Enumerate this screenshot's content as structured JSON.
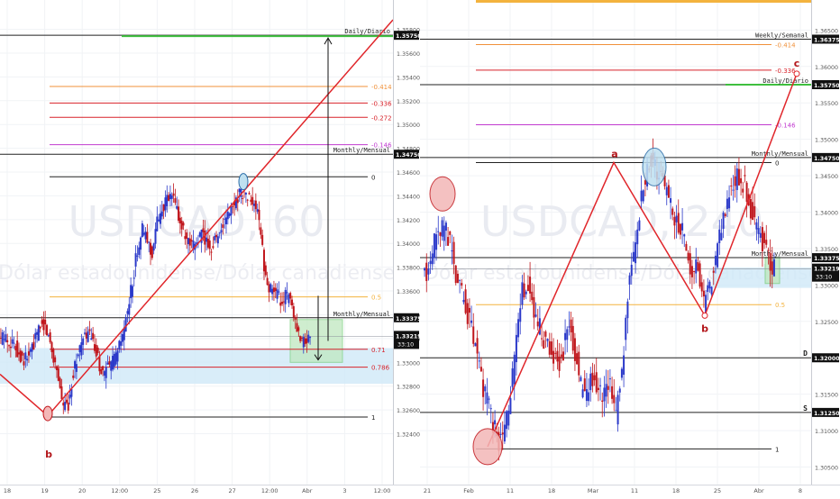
{
  "colors": {
    "up": "#2b39c9",
    "down": "#c0161c",
    "trend": "#e0262b",
    "grid": "#f1f3f6",
    "axis": "#555555",
    "fib_red": "#d8222a",
    "fib_orange": "#f0913a",
    "fib_purple": "#c13bd0",
    "fib_gold": "#f3b33e",
    "zone_blue": "#cfe8f8",
    "zone_green": "#bfe8c0",
    "label_red": "#b3151a"
  },
  "chart_data": [
    {
      "type": "candlestick",
      "watermark": "USDCAD, 60",
      "watermark_sub": "Dólar estadounidense/Dólar canadiense",
      "ylim": [
        1.3226,
        1.3588
      ],
      "y_ticks": [
        1.324,
        1.326,
        1.328,
        1.33,
        1.332,
        1.334,
        1.336,
        1.338,
        1.34,
        1.342,
        1.344,
        1.346,
        1.348,
        1.35,
        1.352,
        1.354,
        1.356,
        1.358
      ],
      "y_tick_labels": [
        "1.32400",
        "1.32600",
        "1.32800",
        "1.33000",
        "1.33200",
        "1.33400",
        "1.33600",
        "1.33800",
        "1.34000",
        "1.34200",
        "1.34400",
        "1.34600",
        "1.34800",
        "1.35000",
        "1.35200",
        "1.35400",
        "1.35600",
        "1.35800"
      ],
      "x_ticks": [
        "18",
        "19",
        "20",
        "12:00",
        "25",
        "26",
        "27",
        "12:00",
        "Abr",
        "3",
        "12:00"
      ],
      "levels": [
        {
          "label": "Daily/Diario",
          "value": 1.3575,
          "price_tag": "1.35750"
        },
        {
          "label": "Monthly/Mensual",
          "value": 1.3475,
          "price_tag": "1.34750"
        },
        {
          "label": "Monthly/Mensual",
          "value": 1.33375,
          "price_tag": "1.33375"
        }
      ],
      "current_price": "1.33219",
      "countdown": "33:10",
      "fib_levels": [
        {
          "label": "-0.414",
          "value": 1.3532
        },
        {
          "label": "-0.336",
          "value": 1.3518
        },
        {
          "label": "-0.272",
          "value": 1.3506
        },
        {
          "label": "-0.146",
          "value": 1.3483
        },
        {
          "label": "0",
          "value": 1.3456
        },
        {
          "label": "0.5",
          "value": 1.3355
        },
        {
          "label": "0.71",
          "value": 1.3311
        },
        {
          "label": "0.786",
          "value": 1.3296
        },
        {
          "label": "1",
          "value": 1.3254
        }
      ],
      "pattern_labels": [
        "b"
      ],
      "series": [
        {
          "name": "price",
          "values": [
            1.3322,
            1.3318,
            1.3315,
            1.3308,
            1.3302,
            1.3306,
            1.3315,
            1.3328,
            1.3333,
            1.3322,
            1.3305,
            1.3288,
            1.3262,
            1.3265,
            1.3292,
            1.3308,
            1.3318,
            1.3325,
            1.3316,
            1.3302,
            1.329,
            1.3295,
            1.33,
            1.3308,
            1.3322,
            1.3342,
            1.3368,
            1.3395,
            1.3412,
            1.3402,
            1.3392,
            1.3418,
            1.343,
            1.3436,
            1.344,
            1.3428,
            1.3414,
            1.34,
            1.3396,
            1.3402,
            1.3408,
            1.3401,
            1.3397,
            1.3406,
            1.3413,
            1.3421,
            1.3428,
            1.3438,
            1.3444,
            1.344,
            1.3436,
            1.343,
            1.3409,
            1.3368,
            1.3362,
            1.3358,
            1.3352,
            1.3356,
            1.3352,
            1.333,
            1.3316,
            1.3318,
            1.3321
          ]
        }
      ]
    },
    {
      "type": "candlestick",
      "watermark": "USDCAD, 240",
      "watermark_sub": "Dólar estadounidense/Dólar canadiense",
      "ylim": [
        1.3042,
        1.3669
      ],
      "y_ticks": [
        1.305,
        1.31,
        1.315,
        1.32,
        1.325,
        1.33,
        1.335,
        1.34,
        1.345,
        1.35,
        1.355,
        1.36,
        1.365
      ],
      "y_tick_labels": [
        "1.30500",
        "1.31000",
        "1.31500",
        "1.32000",
        "1.32500",
        "1.33000",
        "1.33500",
        "1.34000",
        "1.34500",
        "1.35000",
        "1.35500",
        "1.36000",
        "1.36500"
      ],
      "x_ticks": [
        "21",
        "Feb",
        "11",
        "18",
        "Mar",
        "11",
        "18",
        "25",
        "Abr",
        "8"
      ],
      "levels": [
        {
          "label": "Weekly/Semanal",
          "value": 1.36375,
          "price_tag": "1.36375"
        },
        {
          "label": "Daily/Diario",
          "value": 1.3575,
          "price_tag": "1.35750"
        },
        {
          "label": "Monthly/Mensual",
          "value": 1.3475,
          "price_tag": "1.34750"
        },
        {
          "label": "Monthly/Mensual",
          "value": 1.33375,
          "price_tag": "1.33375"
        },
        {
          "label": "D",
          "value": 1.32,
          "price_tag": "1.32000"
        },
        {
          "label": "S",
          "value": 1.3125,
          "price_tag": "1.31250"
        }
      ],
      "current_price": "1.33219",
      "countdown": "33:10",
      "fib_levels": [
        {
          "label": "-0.414",
          "value": 1.363
        },
        {
          "label": "-0.336",
          "value": 1.3595
        },
        {
          "label": "-0.146",
          "value": 1.352
        },
        {
          "label": "0",
          "value": 1.3468
        },
        {
          "label": "0.5",
          "value": 1.3273
        },
        {
          "label": "1",
          "value": 1.3075
        }
      ],
      "pattern_labels": [
        "a",
        "b",
        "c"
      ],
      "series": [
        {
          "name": "price",
          "values": [
            1.3321,
            1.336,
            1.3372,
            1.338,
            1.3346,
            1.33,
            1.328,
            1.325,
            1.322,
            1.3168,
            1.314,
            1.311,
            1.3085,
            1.3105,
            1.315,
            1.322,
            1.329,
            1.33,
            1.326,
            1.324,
            1.322,
            1.3205,
            1.319,
            1.321,
            1.325,
            1.321,
            1.316,
            1.315,
            1.3175,
            1.3155,
            1.3148,
            1.3165,
            1.312,
            1.318,
            1.329,
            1.334,
            1.34,
            1.345,
            1.347,
            1.3452,
            1.344,
            1.342,
            1.3395,
            1.338,
            1.335,
            1.331,
            1.333,
            1.327,
            1.33,
            1.333,
            1.338,
            1.342,
            1.344,
            1.3448,
            1.3437,
            1.34,
            1.338,
            1.336,
            1.3335,
            1.3322
          ]
        }
      ]
    }
  ]
}
